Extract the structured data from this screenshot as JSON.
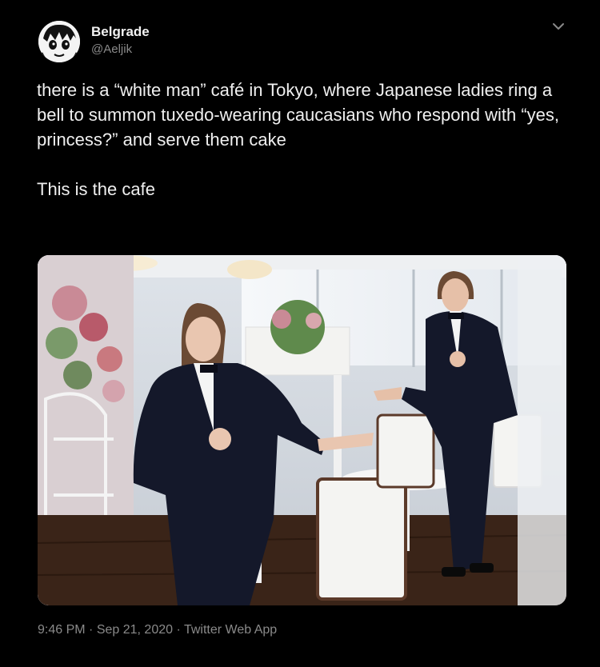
{
  "author": {
    "display_name": "Belgrade",
    "handle": "@Aeljik",
    "avatar_icon": "anime-face-avatar"
  },
  "menu_icon": "chevron-down-icon",
  "tweet": {
    "paragraph_1": "there is a “white man” café in Tokyo, where Japanese ladies ring a bell to summon tuxedo-wearing caucasians who respond with “yes, princess?” and serve them cake",
    "paragraph_2": "This is the cafe"
  },
  "photo": {
    "icon": "cafe-photo",
    "description_colors": {
      "tuxedo": "#14182a",
      "wall": "#e8ecf0",
      "floor": "#3a2418",
      "flowers": "#c98a96"
    }
  },
  "meta": {
    "time": "9:46 PM",
    "date": "Sep 21, 2020",
    "client": "Twitter Web App"
  },
  "colors": {
    "background": "#000000",
    "text": "#f0f0f0",
    "secondary": "#8a8a8a"
  }
}
